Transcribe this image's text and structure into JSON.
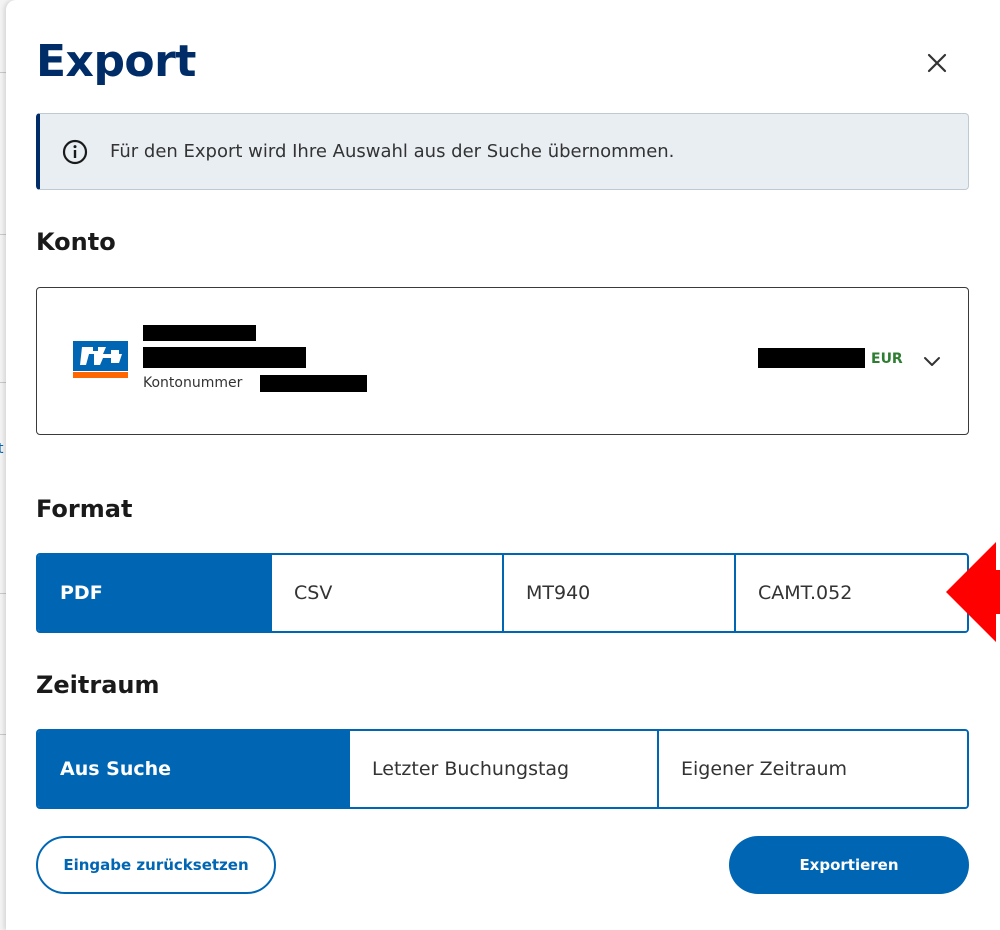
{
  "dialog": {
    "title": "Export",
    "info_message": "Für den Export wird Ihre Auswahl aus der Suche übernommen."
  },
  "account": {
    "section_label": "Konto",
    "account_number_label": "Kontonummer",
    "currency": "EUR",
    "bank_logo": "volksbank-logo",
    "name_line1": "[redacted]",
    "name_line2": "[redacted]",
    "account_number": "[redacted]",
    "balance": "[redacted]"
  },
  "format": {
    "section_label": "Format",
    "options": [
      "PDF",
      "CSV",
      "MT940",
      "CAMT.052"
    ],
    "selected": "PDF"
  },
  "period": {
    "section_label": "Zeitraum",
    "options": [
      "Aus Suche",
      "Letzter Buchungstag",
      "Eigener Zeitraum"
    ],
    "selected": "Aus Suche"
  },
  "actions": {
    "reset_label": "Eingabe zurücksetzen",
    "export_label": "Exportieren"
  },
  "background": {
    "partial_letter": "t"
  },
  "colors": {
    "primary": "#0066b3",
    "title": "#002d67",
    "currency": "#2e7d32",
    "annotation_arrow": "#ff0000"
  },
  "icons": {
    "close": "close-icon",
    "info": "info-icon",
    "dropdown": "chevron-down-icon",
    "annotation": "arrow-left-annotation"
  }
}
